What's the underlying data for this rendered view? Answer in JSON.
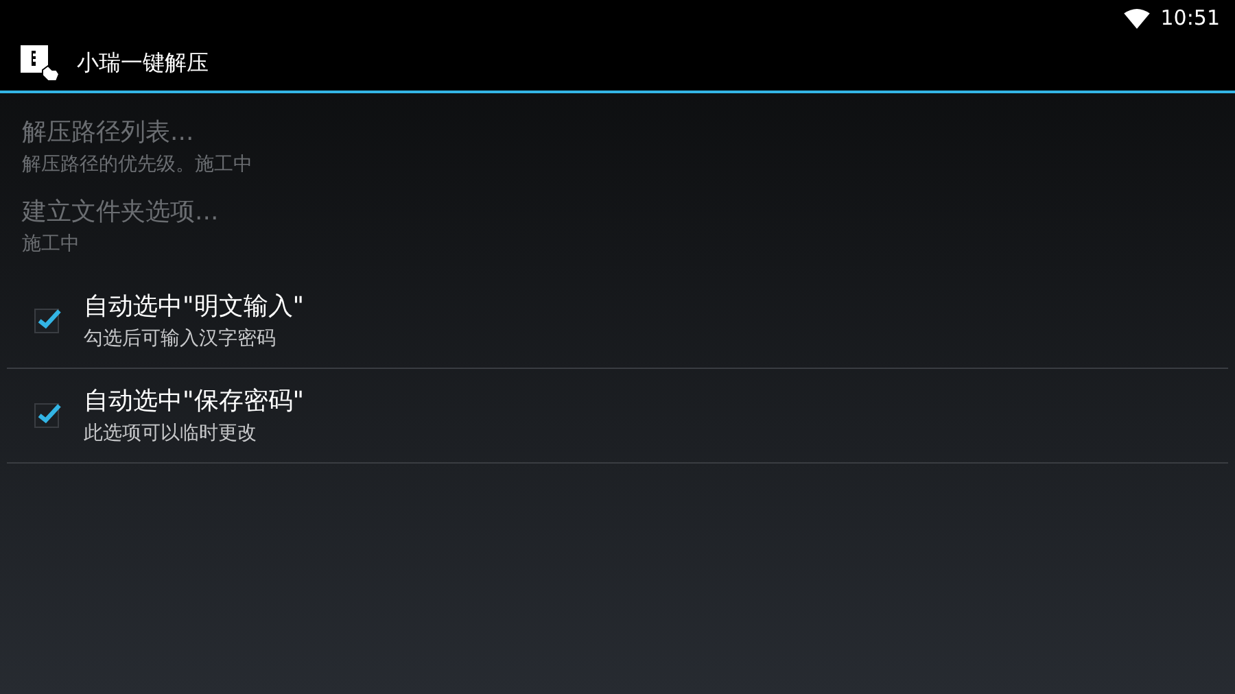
{
  "status_bar": {
    "time": "10:51"
  },
  "action_bar": {
    "title": "小瑞一键解压"
  },
  "preferences": [
    {
      "kind": "link",
      "title": "解压路径列表...",
      "summary": "解压路径的优先级。施工中",
      "disabled": true
    },
    {
      "kind": "link",
      "title": "建立文件夹选项...",
      "summary": "施工中",
      "disabled": true
    },
    {
      "kind": "checkbox",
      "title": "自动选中\"明文输入\"",
      "summary": "勾选后可输入汉字密码",
      "disabled": false,
      "checked": true
    },
    {
      "kind": "checkbox",
      "title": "自动选中\"保存密码\"",
      "summary": "此选项可以临时更改",
      "disabled": false,
      "checked": true
    }
  ]
}
